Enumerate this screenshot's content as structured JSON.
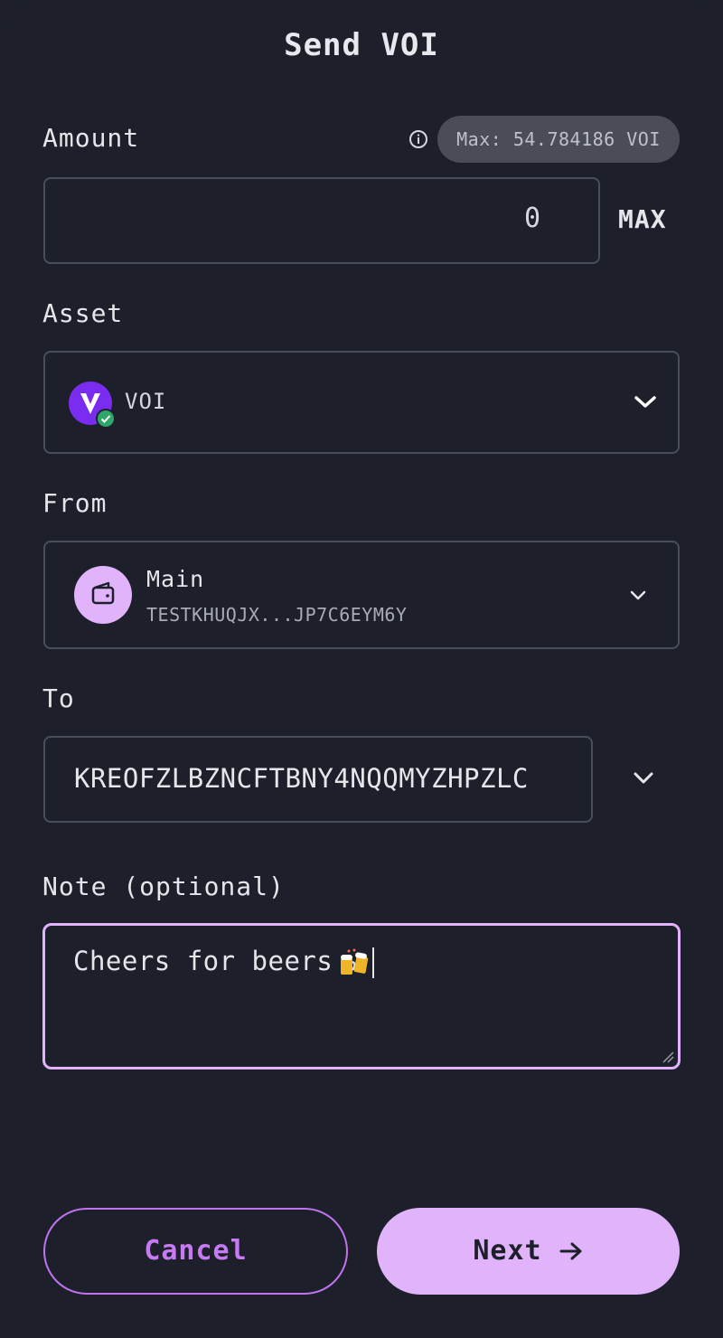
{
  "modal": {
    "title": "Send VOI"
  },
  "amount": {
    "label": "Amount",
    "max_pill": "Max: 54.784186 VOI",
    "value": "0",
    "max_button": "MAX"
  },
  "asset": {
    "label": "Asset",
    "selected": "VOI",
    "icon": "voi-logo-icon",
    "verified": true
  },
  "from": {
    "label": "From",
    "wallet_name": "Main",
    "wallet_address": "TESTKHUQJX...JP7C6EYM6Y",
    "icon": "wallet-icon"
  },
  "to": {
    "label": "To",
    "value": "KREOFZLBZNCFTBNY4NQQMYZHPZLC"
  },
  "note": {
    "label": "Note (optional)",
    "value": "Cheers for beers",
    "emoji_icon": "beer-mugs-icon"
  },
  "actions": {
    "cancel_label": "Cancel",
    "next_label": "Next"
  },
  "colors": {
    "background": "#1d202b",
    "accent": "#e1b3fb",
    "accent_text": "#c77af2",
    "voi_purple": "#7a2df0",
    "verified_green": "#2ea66a"
  }
}
